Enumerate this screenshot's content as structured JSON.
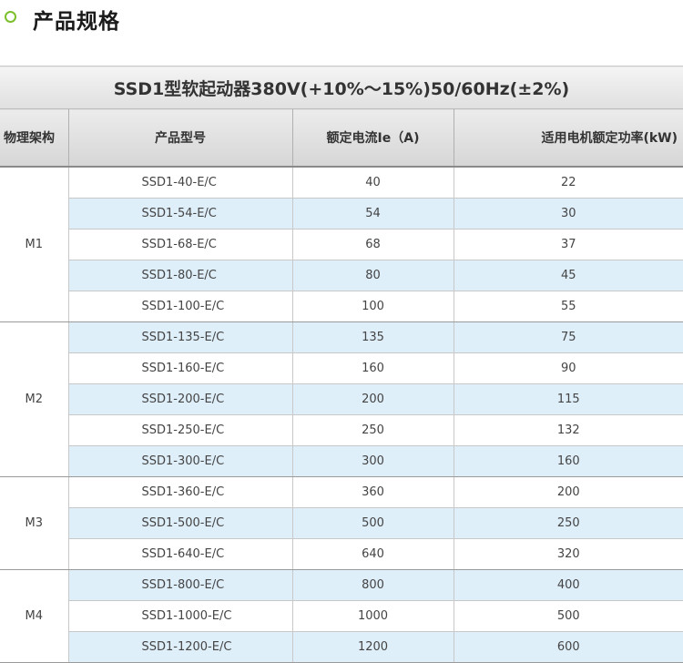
{
  "section": {
    "title": "产品规格"
  },
  "table": {
    "caption": "SSD1型软起动器380V(+10%～15%)50/60Hz(±2%)",
    "headers": {
      "frame": "物理架构",
      "model": "产品型号",
      "current": "额定电流Ie（A)",
      "power": "适用电机额定功率(kW)"
    },
    "groups": [
      {
        "frame": "M1",
        "rows": [
          {
            "model": "SSD1-40-E/C",
            "current": "40",
            "power": "22"
          },
          {
            "model": "SSD1-54-E/C",
            "current": "54",
            "power": "30"
          },
          {
            "model": "SSD1-68-E/C",
            "current": "68",
            "power": "37"
          },
          {
            "model": "SSD1-80-E/C",
            "current": "80",
            "power": "45"
          },
          {
            "model": "SSD1-100-E/C",
            "current": "100",
            "power": "55"
          }
        ]
      },
      {
        "frame": "M2",
        "rows": [
          {
            "model": "SSD1-135-E/C",
            "current": "135",
            "power": "75"
          },
          {
            "model": "SSD1-160-E/C",
            "current": "160",
            "power": "90"
          },
          {
            "model": "SSD1-200-E/C",
            "current": "200",
            "power": "115"
          },
          {
            "model": "SSD1-250-E/C",
            "current": "250",
            "power": "132"
          },
          {
            "model": "SSD1-300-E/C",
            "current": "300",
            "power": "160"
          }
        ]
      },
      {
        "frame": "M3",
        "rows": [
          {
            "model": "SSD1-360-E/C",
            "current": "360",
            "power": "200"
          },
          {
            "model": "SSD1-500-E/C",
            "current": "500",
            "power": "250"
          },
          {
            "model": "SSD1-640-E/C",
            "current": "640",
            "power": "320"
          }
        ]
      },
      {
        "frame": "M4",
        "rows": [
          {
            "model": "SSD1-800-E/C",
            "current": "800",
            "power": "400"
          },
          {
            "model": "SSD1-1000-E/C",
            "current": "1000",
            "power": "500"
          },
          {
            "model": "SSD1-1200-E/C",
            "current": "1200",
            "power": "600"
          }
        ]
      }
    ]
  },
  "colors": {
    "accent": "#7cbf2c",
    "row_shade": "#dfeffa",
    "header_bg": "#e0e0e0"
  }
}
